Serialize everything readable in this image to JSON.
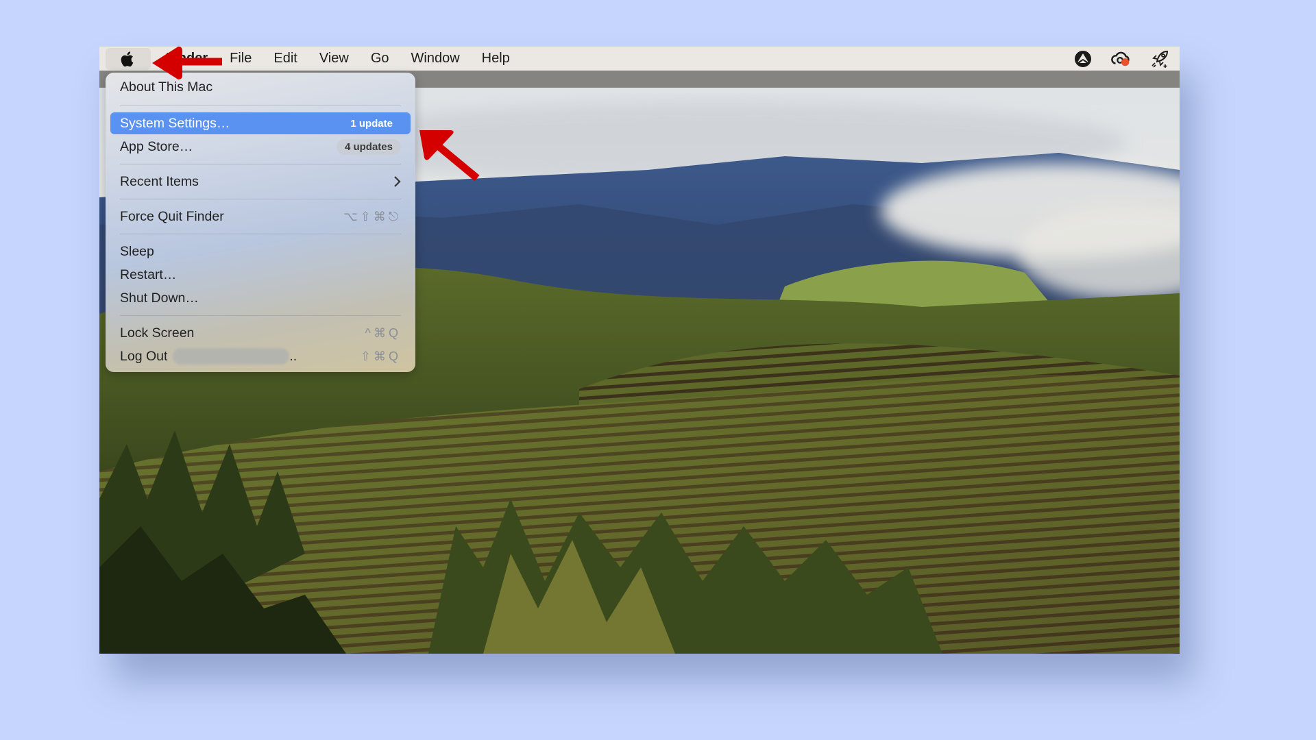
{
  "menubar": {
    "apple_icon": "apple-logo",
    "app_name": "Finder",
    "items": [
      "File",
      "Edit",
      "View",
      "Go",
      "Window",
      "Help"
    ],
    "status_icons": [
      "vpn-icon",
      "creative-cloud-icon",
      "rocket-icon"
    ],
    "status_dot_color": "#e8512a"
  },
  "apple_menu": {
    "about": "About This Mac",
    "system_settings": "System Settings…",
    "system_settings_badge": "1 update",
    "app_store": "App Store…",
    "app_store_badge": "4 updates",
    "recent_items": "Recent Items",
    "force_quit": "Force Quit Finder",
    "force_quit_shortcut": "⌥⇧⌘⎋",
    "sleep": "Sleep",
    "restart": "Restart…",
    "shut_down": "Shut Down…",
    "lock_screen": "Lock Screen",
    "lock_screen_shortcut": "^⌘Q",
    "log_out": "Log Out",
    "log_out_suffix": "..",
    "log_out_shortcut": "⇧⌘Q",
    "highlight_color": "#5a92f2"
  },
  "annotations": {
    "arrow_color": "#d40000"
  }
}
